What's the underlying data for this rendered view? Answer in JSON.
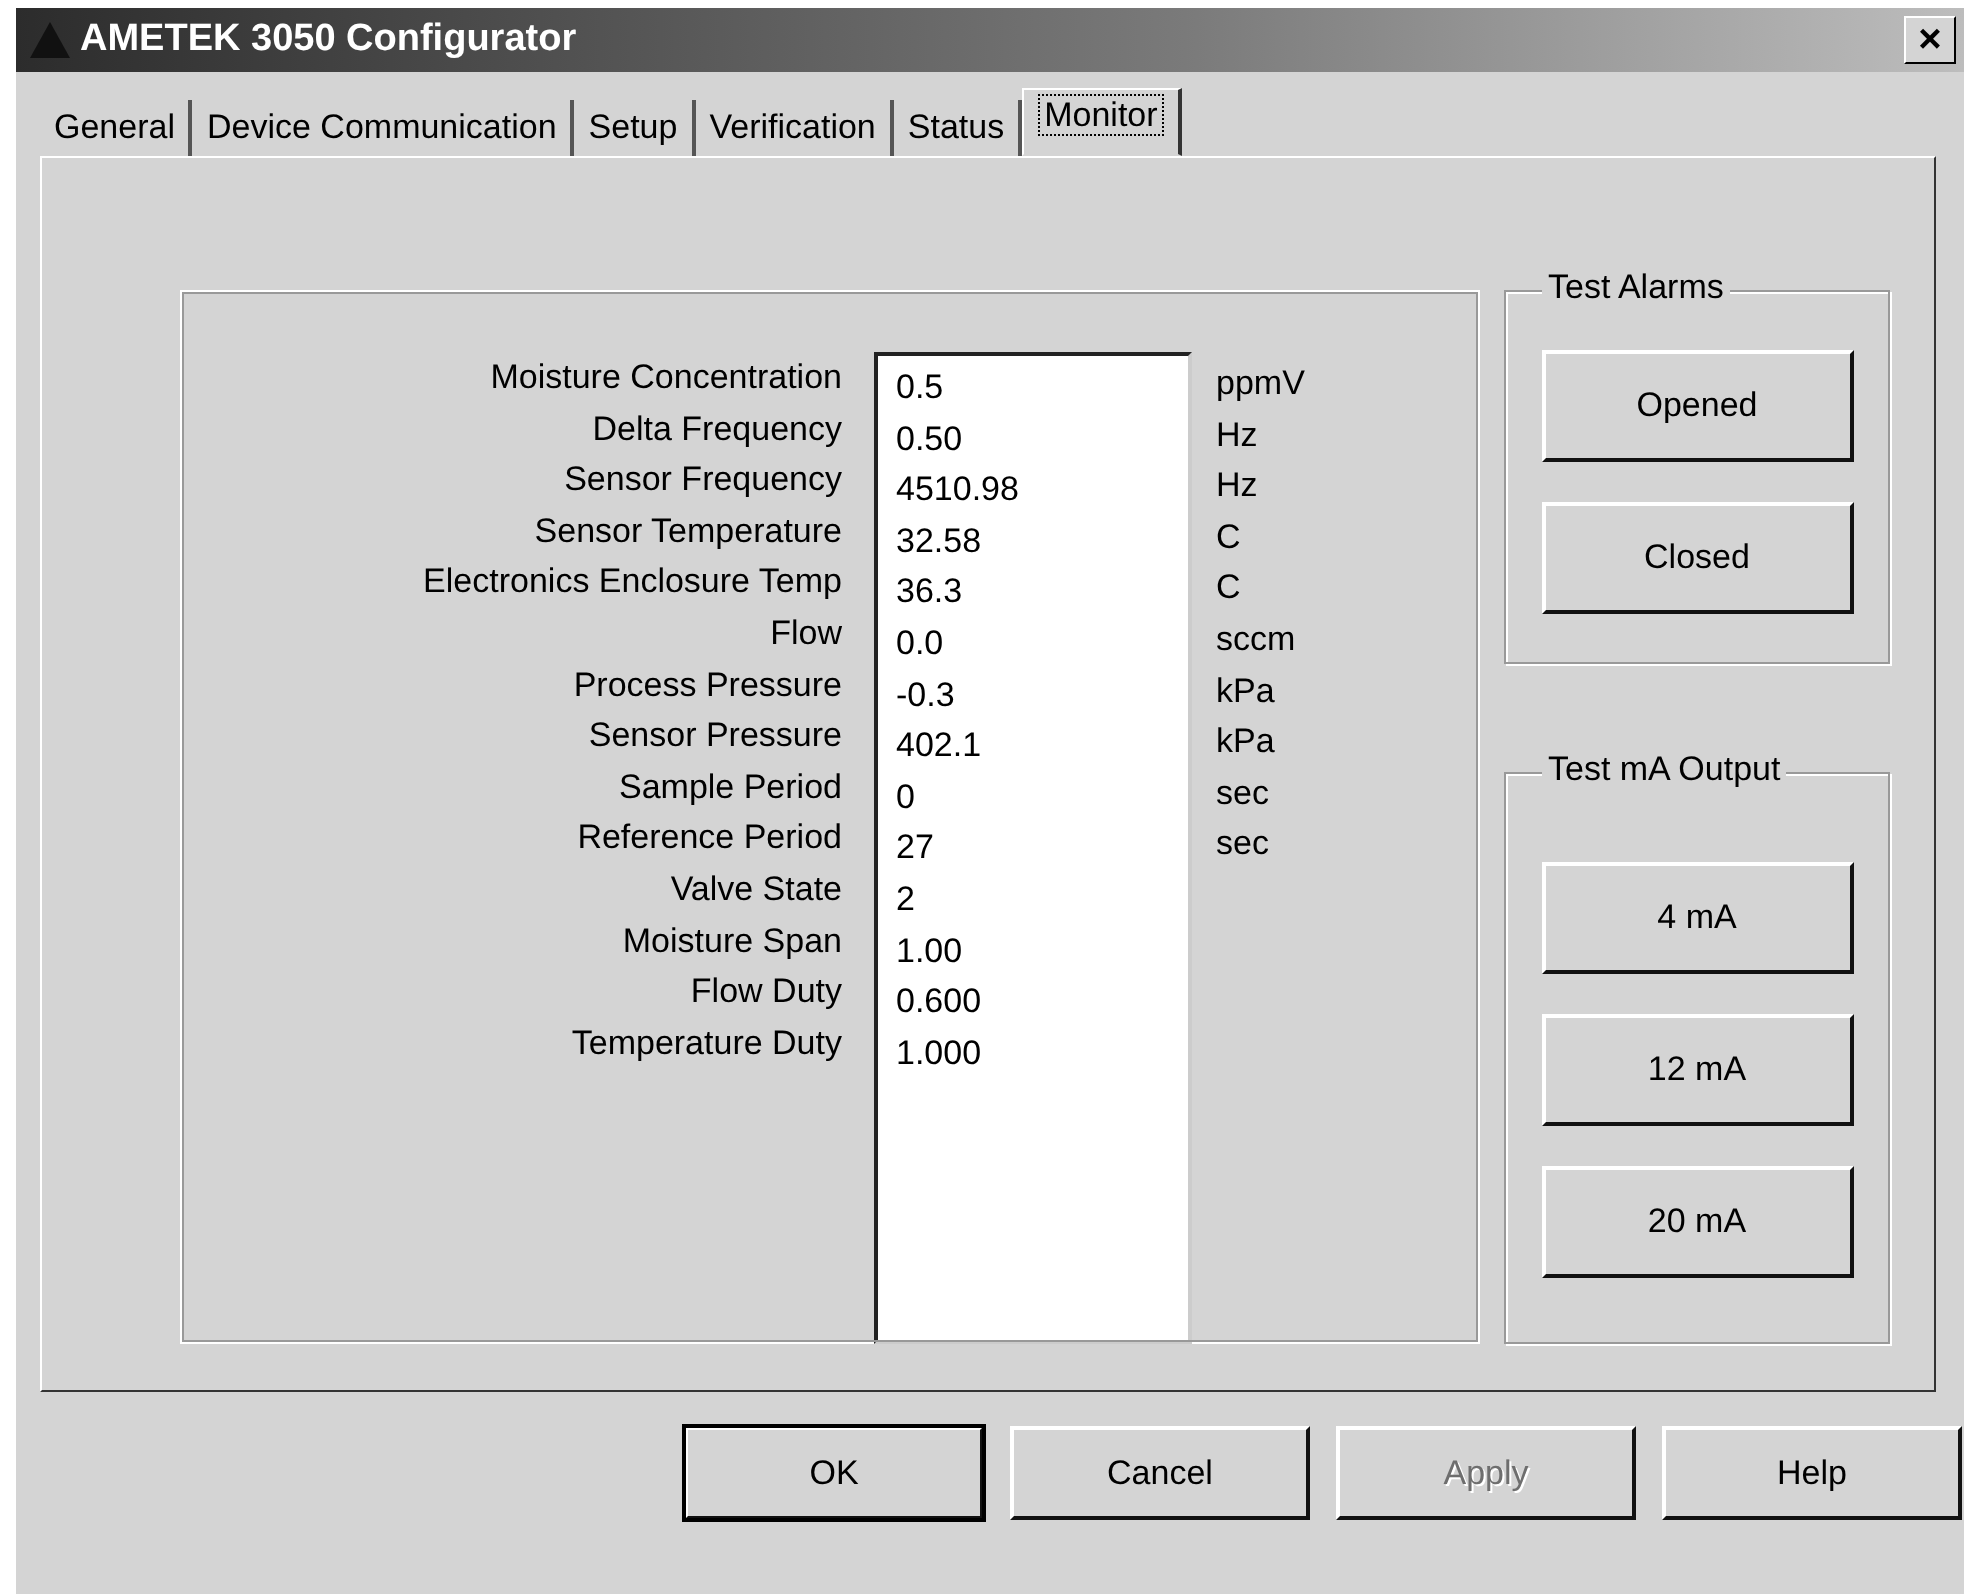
{
  "window": {
    "title": "AMETEK 3050 Configurator",
    "close": "×"
  },
  "tabs": [
    {
      "label": "General",
      "selected": false
    },
    {
      "label": "Device Communication",
      "selected": false
    },
    {
      "label": "Setup",
      "selected": false
    },
    {
      "label": "Verification",
      "selected": false
    },
    {
      "label": "Status",
      "selected": false
    },
    {
      "label": "Monitor",
      "selected": true
    }
  ],
  "readings": [
    {
      "label": "Moisture Concentration",
      "value": "0.5",
      "unit": "ppmV"
    },
    {
      "label": "Delta Frequency",
      "value": "0.50",
      "unit": "Hz"
    },
    {
      "label": "Sensor Frequency",
      "value": "4510.98",
      "unit": "Hz"
    },
    {
      "label": "Sensor Temperature",
      "value": "32.58",
      "unit": "C"
    },
    {
      "label": "Electronics Enclosure Temp",
      "value": "36.3",
      "unit": "C"
    },
    {
      "label": "Flow",
      "value": "0.0",
      "unit": "sccm"
    },
    {
      "label": "Process Pressure",
      "value": "-0.3",
      "unit": "kPa"
    },
    {
      "label": "Sensor Pressure",
      "value": "402.1",
      "unit": "kPa"
    },
    {
      "label": "Sample Period",
      "value": "0",
      "unit": "sec"
    },
    {
      "label": "Reference Period",
      "value": "27",
      "unit": "sec"
    },
    {
      "label": "Valve State",
      "value": "2"
    },
    {
      "label": "Moisture Span",
      "value": "1.00"
    },
    {
      "label": "Flow Duty",
      "value": "0.600"
    },
    {
      "label": "Temperature Duty",
      "value": "1.000"
    }
  ],
  "groups": [
    {
      "title": "Test Alarms",
      "buttons": [
        "Opened",
        "Closed"
      ]
    },
    {
      "title": "Test mA Output",
      "buttons": [
        "4 mA",
        "12 mA",
        "20 mA"
      ]
    }
  ],
  "buttons": [
    {
      "label": "OK",
      "default": true,
      "disabled": false
    },
    {
      "label": "Cancel",
      "default": false,
      "disabled": false
    },
    {
      "label": "Apply",
      "default": false,
      "disabled": true
    },
    {
      "label": "Help",
      "default": false,
      "disabled": false
    }
  ]
}
